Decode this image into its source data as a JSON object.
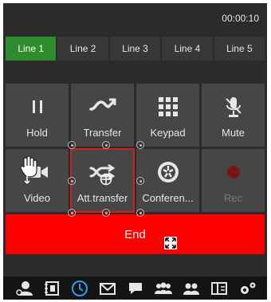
{
  "header": {
    "timer": "00:00:10"
  },
  "lines": [
    {
      "label": "Line 1",
      "active": true
    },
    {
      "label": "Line 2",
      "active": false
    },
    {
      "label": "Line 3",
      "active": false
    },
    {
      "label": "Line 4",
      "active": false
    },
    {
      "label": "Line 5",
      "active": false
    }
  ],
  "controls": {
    "hold": "Hold",
    "transfer": "Transfer",
    "keypad": "Keypad",
    "mute": "Mute",
    "video": "Video",
    "att_transfer": "Att.transfer",
    "conference": "Conferen...",
    "rec": "Rec"
  },
  "end_label": "End",
  "colors": {
    "active_line": "#2e8b2e",
    "end_button": "#ff0000",
    "selection": "#d21f1f",
    "history_icon": "#2a9df4",
    "rec_icon": "#7a1515"
  },
  "toolbar_icons": [
    "contacts-icon",
    "phonebook-icon",
    "history-icon",
    "messages-icon",
    "chat-icon",
    "groups-icon",
    "conference-users-icon",
    "layout-icon",
    "settings-icon"
  ]
}
